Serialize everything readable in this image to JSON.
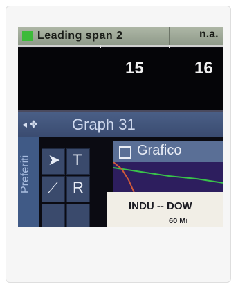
{
  "header": {
    "title": "Leading span 2",
    "value": "n.a."
  },
  "axis": {
    "labels": [
      "15",
      "16"
    ]
  },
  "graph": {
    "title": "Graph 31",
    "tab_label": "Grafico",
    "side_label": "Preferiti"
  },
  "toolbar": {
    "tools": [
      "cursor-icon",
      "text-icon",
      "line-icon",
      "R"
    ]
  },
  "popup": {
    "line1": "INDU -- DOW",
    "line2": "60 Mi"
  }
}
